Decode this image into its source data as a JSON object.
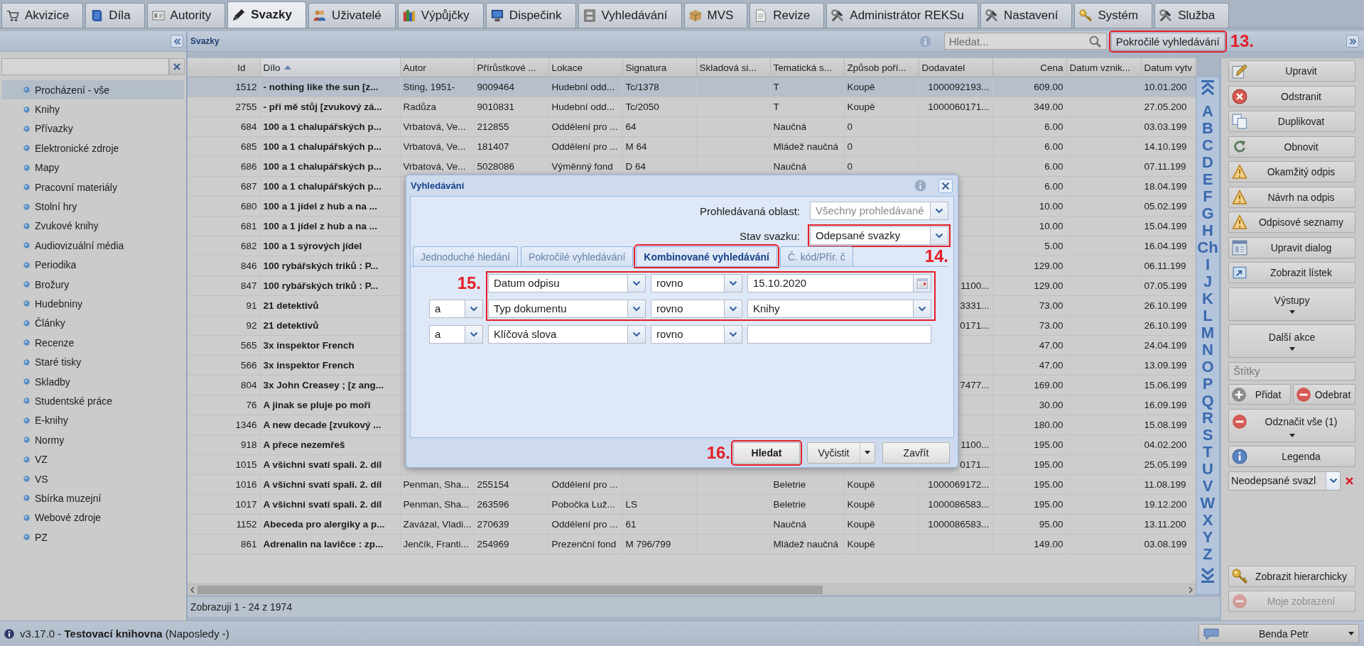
{
  "app_tabs": [
    {
      "label": "Akvizice",
      "selected": false
    },
    {
      "label": "Díla",
      "selected": false
    },
    {
      "label": "Autority",
      "selected": false
    },
    {
      "label": "Svazky",
      "selected": true
    },
    {
      "label": "Uživatelé",
      "selected": false
    },
    {
      "label": "Výpůjčky",
      "selected": false
    },
    {
      "label": "Dispečink",
      "selected": false
    },
    {
      "label": "Vyhledávání",
      "selected": false
    },
    {
      "label": "MVS",
      "selected": false
    },
    {
      "label": "Revize",
      "selected": false
    },
    {
      "label": "Administrátor REKSu",
      "selected": false
    },
    {
      "label": "Nastavení",
      "selected": false
    },
    {
      "label": "Systém",
      "selected": false
    },
    {
      "label": "Služba",
      "selected": false
    }
  ],
  "sidebar": {
    "items": [
      {
        "label": "Procházení - vše",
        "selected": true
      },
      {
        "label": "Knihy",
        "selected": false
      },
      {
        "label": "Přívazky",
        "selected": false
      },
      {
        "label": "Elektronické zdroje",
        "selected": false
      },
      {
        "label": "Mapy",
        "selected": false
      },
      {
        "label": "Pracovní materiály",
        "selected": false
      },
      {
        "label": "Stolní hry",
        "selected": false
      },
      {
        "label": "Zvukové knihy",
        "selected": false
      },
      {
        "label": "Audiovizuální média",
        "selected": false
      },
      {
        "label": "Periodika",
        "selected": false
      },
      {
        "label": "Brožury",
        "selected": false
      },
      {
        "label": "Hudebniny",
        "selected": false
      },
      {
        "label": "Články",
        "selected": false
      },
      {
        "label": "Recenze",
        "selected": false
      },
      {
        "label": "Staré tisky",
        "selected": false
      },
      {
        "label": "Skladby",
        "selected": false
      },
      {
        "label": "Studentské práce",
        "selected": false
      },
      {
        "label": "E-knihy",
        "selected": false
      },
      {
        "label": "Normy",
        "selected": false
      },
      {
        "label": "VZ",
        "selected": false
      },
      {
        "label": "VS",
        "selected": false
      },
      {
        "label": "Sbírka muzejní",
        "selected": false
      },
      {
        "label": "Webové zdroje",
        "selected": false
      },
      {
        "label": "PZ",
        "selected": false
      }
    ]
  },
  "header": {
    "title": "Svazky",
    "search": {
      "placeholder": "Hledat..."
    },
    "advanced_search": {
      "label": "Pokročilé vyhledávání",
      "highlighted": true,
      "callout": "13."
    }
  },
  "table": {
    "columns": [
      {
        "label": "Id",
        "sorted": false
      },
      {
        "label": "Dílo",
        "sorted": true
      },
      {
        "label": "Autor",
        "sorted": false
      },
      {
        "label": "Přírůstkové ...",
        "sorted": false
      },
      {
        "label": "Lokace",
        "sorted": false
      },
      {
        "label": "Signatura",
        "sorted": false
      },
      {
        "label": "Skladová si...",
        "sorted": false
      },
      {
        "label": "Tematická s...",
        "sorted": false
      },
      {
        "label": "Způsob poří...",
        "sorted": false
      },
      {
        "label": "Dodavatel",
        "sorted": false
      },
      {
        "label": "Cena",
        "sorted": false
      },
      {
        "label": "Datum vznik...",
        "sorted": false
      },
      {
        "label": "Datum vytv",
        "sorted": false
      }
    ],
    "rows": [
      {
        "selected": true,
        "cells": [
          "1512",
          "- nothing like the sun [z...",
          "Sting, 1951-",
          "9009464",
          "Hudební odd...",
          "Tc/1378",
          null,
          "T",
          "Koupě",
          "1000092193...",
          "609.00",
          null,
          "10.01.200"
        ]
      },
      {
        "selected": false,
        "cells": [
          "2755",
          "- při mě stůj [zvukový zá...",
          "Radůza",
          "9010831",
          "Hudební odd...",
          "Tc/2050",
          null,
          "T",
          "Koupě",
          "1000060171...",
          "349.00",
          null,
          "27.05.200"
        ]
      },
      {
        "selected": false,
        "cells": [
          "684",
          "100 a 1 chalupářských p...",
          "Vrbatová, Ve...",
          "212855",
          "Oddělení pro ...",
          "64",
          null,
          "Naučná",
          "0",
          null,
          "6.00",
          null,
          "03.03.199"
        ]
      },
      {
        "selected": false,
        "cells": [
          "685",
          "100 a 1 chalupářských p...",
          "Vrbatová, Ve...",
          "181407",
          "Oddělení pro ...",
          "M 64",
          null,
          "Mládež naučná",
          "0",
          null,
          "6.00",
          null,
          "14.10.199"
        ]
      },
      {
        "selected": false,
        "cells": [
          "686",
          "100 a 1 chalupářských p...",
          "Vrbatová, Ve...",
          "5028086",
          "Výměnný fond",
          "D 64",
          null,
          "Naučná",
          "0",
          null,
          "6.00",
          null,
          "07.11.199"
        ]
      },
      {
        "selected": false,
        "cells": [
          "687",
          "100 a 1 chalupářských p...",
          null,
          null,
          null,
          null,
          null,
          null,
          null,
          null,
          "6.00",
          null,
          "18.04.199"
        ]
      },
      {
        "selected": false,
        "cells": [
          "680",
          "100 a 1 jídel z hub a na ...",
          null,
          null,
          null,
          null,
          null,
          null,
          null,
          null,
          "10.00",
          null,
          "05.02.199"
        ]
      },
      {
        "selected": false,
        "cells": [
          "681",
          "100 a 1 jídel z hub a na ...",
          null,
          null,
          null,
          null,
          null,
          null,
          null,
          null,
          "10.00",
          null,
          "15.04.199"
        ]
      },
      {
        "selected": false,
        "cells": [
          "682",
          "100 a 1 sýrových jídel",
          null,
          null,
          null,
          null,
          null,
          null,
          null,
          null,
          "5.00",
          null,
          "16.04.199"
        ]
      },
      {
        "selected": false,
        "cells": [
          "846",
          "100 rybářských triků : P...",
          null,
          null,
          null,
          null,
          null,
          null,
          null,
          null,
          "129.00",
          null,
          "06.11.199"
        ]
      },
      {
        "selected": false,
        "cells": [
          "847",
          "100 rybářských triků : P...",
          null,
          null,
          null,
          null,
          null,
          null,
          null,
          "1100...",
          "129.00",
          null,
          "07.05.199"
        ]
      },
      {
        "selected": false,
        "cells": [
          "91",
          "21 detektivů",
          null,
          null,
          null,
          null,
          null,
          null,
          null,
          "3331...",
          "73.00",
          null,
          "26.10.199"
        ]
      },
      {
        "selected": false,
        "cells": [
          "92",
          "21 detektivů",
          null,
          null,
          null,
          null,
          null,
          null,
          null,
          "0171...",
          "73.00",
          null,
          "26.10.199"
        ]
      },
      {
        "selected": false,
        "cells": [
          "565",
          "3x inspektor French",
          null,
          null,
          null,
          null,
          null,
          null,
          null,
          null,
          "47.00",
          null,
          "24.04.199"
        ]
      },
      {
        "selected": false,
        "cells": [
          "566",
          "3x inspektor French",
          null,
          null,
          null,
          null,
          null,
          null,
          null,
          null,
          "47.00",
          null,
          "13.09.199"
        ]
      },
      {
        "selected": false,
        "cells": [
          "804",
          "3x John Creasey ; [z ang...",
          null,
          null,
          null,
          null,
          null,
          null,
          null,
          "7477...",
          "169.00",
          null,
          "15.06.199"
        ]
      },
      {
        "selected": false,
        "cells": [
          "76",
          "A jinak se pluje po moři",
          null,
          null,
          null,
          null,
          null,
          null,
          null,
          null,
          "30.00",
          null,
          "16.09.199"
        ]
      },
      {
        "selected": false,
        "cells": [
          "1346",
          "A new decade [zvukový ...",
          null,
          null,
          null,
          null,
          null,
          null,
          null,
          null,
          "180.00",
          null,
          "15.08.199"
        ]
      },
      {
        "selected": false,
        "cells": [
          "918",
          "A přece nezemřeš",
          null,
          null,
          null,
          null,
          null,
          null,
          null,
          "1100...",
          "195.00",
          null,
          "04.02.200"
        ]
      },
      {
        "selected": false,
        "cells": [
          "1015",
          "A všichni svatí spali. 2. díl",
          null,
          null,
          null,
          null,
          null,
          null,
          null,
          "0171...",
          "195.00",
          null,
          "25.05.199"
        ]
      },
      {
        "selected": false,
        "cells": [
          "1016",
          "A všichni svatí spali. 2. díl",
          "Penman, Sha...",
          "255154",
          "Oddělení pro ...",
          null,
          null,
          "Beletrie",
          "Koupě",
          "1000069172...",
          "195.00",
          null,
          "11.08.199"
        ]
      },
      {
        "selected": false,
        "cells": [
          "1017",
          "A všichni svatí spali. 2. díl",
          "Penman, Sha...",
          "263596",
          "Pobočka Luž...",
          "LS",
          null,
          "Beletrie",
          "Koupě",
          "1000086583...",
          "195.00",
          null,
          "19.12.200"
        ]
      },
      {
        "selected": false,
        "cells": [
          "1152",
          "Abeceda pro alergiky a p...",
          "Zavázal, Vladi...",
          "270639",
          "Oddělení pro ...",
          "61",
          null,
          "Naučná",
          "Koupě",
          "1000086583...",
          "95.00",
          null,
          "13.11.200"
        ]
      },
      {
        "selected": false,
        "cells": [
          "861",
          "Adrenalin na lavičce : zp...",
          "Jenčík, Franti...",
          "254969",
          "Prezenční fond",
          "M 796/799",
          null,
          "Mládež naučná",
          "Koupě",
          null,
          "149.00",
          null,
          "03.08.199"
        ]
      }
    ]
  },
  "alphabet": [
    "A",
    "B",
    "C",
    "D",
    "E",
    "F",
    "G",
    "H",
    "Ch",
    "I",
    "J",
    "K",
    "L",
    "M",
    "N",
    "O",
    "P",
    "Q",
    "R",
    "S",
    "T",
    "U",
    "V",
    "W",
    "X",
    "Y",
    "Z"
  ],
  "paging": "Zobrazuji 1 - 24 z 1974",
  "actions": {
    "top": [
      {
        "kind": "button",
        "label": "Upravit"
      },
      {
        "kind": "button",
        "label": "Odstranit"
      },
      {
        "kind": "button",
        "label": "Duplikovat"
      },
      {
        "kind": "button",
        "label": "Obnovit"
      },
      {
        "kind": "button",
        "label": "Okamžitý odpis"
      },
      {
        "kind": "button",
        "label": "Návrh na odpis"
      },
      {
        "kind": "button",
        "label": "Odpisové seznamy"
      },
      {
        "kind": "button",
        "label": "Upravit dialog"
      },
      {
        "kind": "button",
        "label": "Zobrazit lístek"
      },
      {
        "kind": "menu",
        "label": "Výstupy"
      },
      {
        "kind": "menu",
        "label": "Další akce"
      },
      {
        "kind": "field",
        "placeholder": "Štítky"
      },
      {
        "kind": "pair",
        "buttons": [
          {
            "label": "Přidat"
          },
          {
            "label": "Odebrat"
          }
        ]
      },
      {
        "kind": "menu",
        "label": "Odznačit vše (1)"
      },
      {
        "kind": "button",
        "label": "Legenda"
      },
      {
        "kind": "combo",
        "value": "Neodepsané svazl"
      }
    ],
    "bottom": [
      {
        "label": "Zobrazit hierarchicky",
        "disabled": false
      },
      {
        "label": "Moje zobrazení",
        "disabled": true
      }
    ]
  },
  "dialog": {
    "title": "Vyhledávání",
    "fields": [
      {
        "label": "Prohledávaná oblast:",
        "value": "Všechny prohledávané",
        "disabled": true,
        "highlighted": false
      },
      {
        "label": "Stav svazku:",
        "value": "Odepsané svazky",
        "disabled": false,
        "highlighted": true,
        "callout": "14."
      }
    ],
    "tabs": [
      {
        "label": "Jednoduché hledání",
        "selected": false,
        "highlighted": false
      },
      {
        "label": "Pokročilé vyhledávání",
        "selected": false,
        "highlighted": false
      },
      {
        "label": "Kombinované vyhledávání",
        "selected": true,
        "highlighted": true
      },
      {
        "label": "Č. kód/Přír. č",
        "selected": false,
        "highlighted": false
      }
    ],
    "conditions": [
      {
        "field": "Datum odpisu",
        "operator": "rovno",
        "kind": "date",
        "value": "15.10.2020",
        "highlighted": true,
        "callout": "15."
      },
      {
        "conjunction": "a",
        "field": "Typ dokumentu",
        "operator": "rovno",
        "kind": "combo",
        "value": "Knihy",
        "highlighted": true
      },
      {
        "conjunction": "a",
        "field": "Klíčová slova",
        "operator": "rovno",
        "kind": "text",
        "highlighted": false
      }
    ],
    "buttons": [
      {
        "kind": "primary",
        "label": "Hledat",
        "highlighted": true,
        "callout": "16."
      },
      {
        "kind": "split",
        "label": "Vyčistit",
        "highlighted": false
      },
      {
        "kind": "plain",
        "label": "Zavřít",
        "highlighted": false
      }
    ]
  },
  "status_bar": {
    "text": "v3.17.0 - **Testovací knihovna** (Naposledy -)",
    "user": "Benda Petr"
  }
}
